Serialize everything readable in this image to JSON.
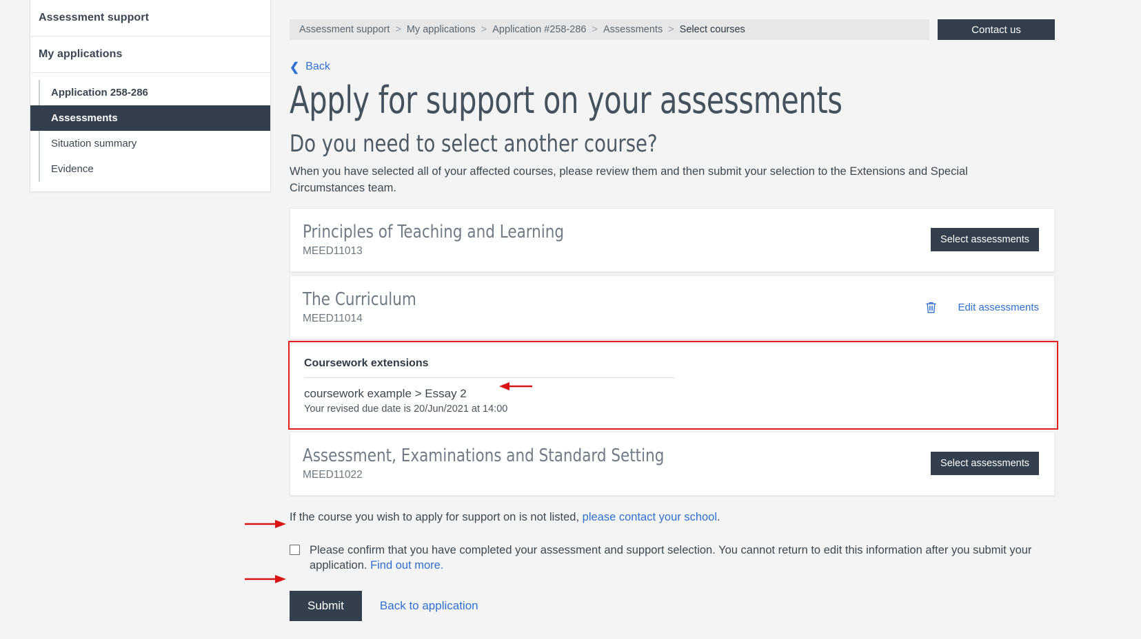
{
  "sidebar": {
    "sections": [
      {
        "label": "Assessment support"
      },
      {
        "label": "My applications"
      }
    ],
    "items": [
      {
        "label": "Application 258-286",
        "active": false,
        "bold": true
      },
      {
        "label": "Assessments",
        "active": true,
        "bold": true
      },
      {
        "label": "Situation summary",
        "active": false,
        "bold": false
      },
      {
        "label": "Evidence",
        "active": false,
        "bold": false
      }
    ]
  },
  "breadcrumb": {
    "items": [
      "Assessment support",
      "My applications",
      "Application #258-286",
      "Assessments",
      "Select courses"
    ],
    "separator": ">"
  },
  "header": {
    "contact_button": "Contact us"
  },
  "back": {
    "label": "Back",
    "chevron": "‹"
  },
  "main": {
    "title": "Apply for support on your assessments",
    "subtitle": "Do you need to select another course?",
    "intro": "When you have selected all of your affected courses, please review them and then submit your selection to the Extensions and Special Circumstances team."
  },
  "courses": [
    {
      "name": "Principles of Teaching and Learning",
      "code": "MEED11013",
      "action_type": "select",
      "action_label": "Select assessments"
    },
    {
      "name": "The Curriculum",
      "code": "MEED11014",
      "action_type": "edit",
      "action_label": "Edit assessments",
      "delete_icon": "trash-icon"
    },
    {
      "name": "Assessment, Examinations and Standard Setting",
      "code": "MEED11022",
      "action_type": "select",
      "action_label": "Select assessments"
    }
  ],
  "extension_panel": {
    "title": "Coursework extensions",
    "item": "coursework example > Essay 2",
    "revised_due": "Your revised due date is 20/Jun/2021 at 14:00",
    "highlight_color": "#e32020"
  },
  "footer": {
    "not_listed_prefix": "If the course you wish to apply for support on is not listed, ",
    "not_listed_link": "please contact your school",
    "not_listed_suffix": ".",
    "confirm_text": "Please confirm that you have completed your assessment and support selection. You cannot return to edit this information after you submit your application. ",
    "confirm_link": "Find out more.",
    "submit_label": "Submit",
    "back_to_application": "Back to application"
  },
  "annotations": {
    "arrow_color": "#d81414",
    "arrow_targets": [
      "revised-due-date",
      "confirm-checkbox",
      "submit-button"
    ]
  }
}
